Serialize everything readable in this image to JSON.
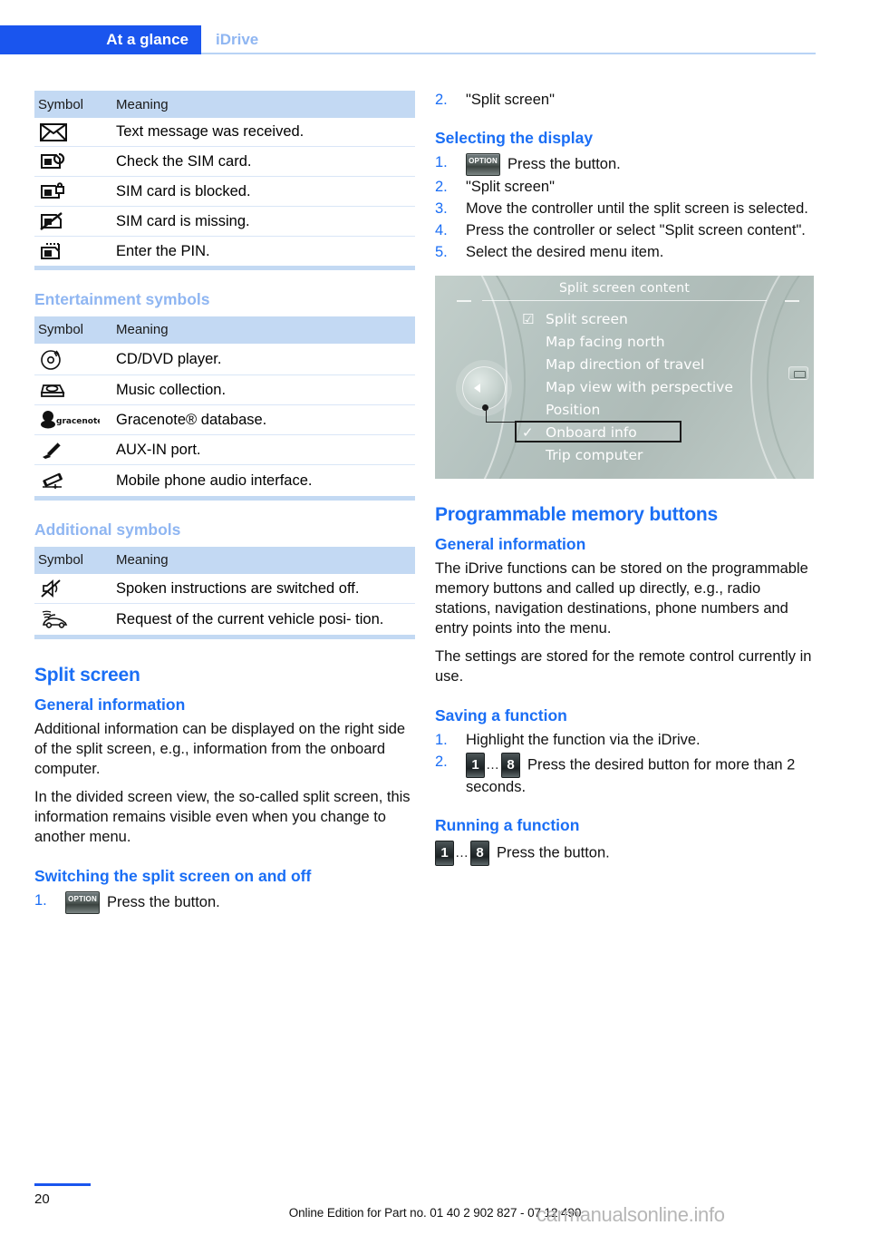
{
  "header": {
    "active_tab": "At a glance",
    "sub_tab": "iDrive"
  },
  "tables": {
    "col_headers": {
      "symbol": "Symbol",
      "meaning": "Meaning"
    },
    "telephone_rows": [
      {
        "icon": "envelope-icon",
        "meaning": "Text message was received."
      },
      {
        "icon": "sim-check-icon",
        "meaning": "Check the SIM card."
      },
      {
        "icon": "sim-locked-icon",
        "meaning": "SIM card is blocked."
      },
      {
        "icon": "sim-missing-icon",
        "meaning": "SIM card is missing."
      },
      {
        "icon": "sim-pin-icon",
        "meaning": "Enter the PIN."
      }
    ],
    "entertainment_heading": "Entertainment symbols",
    "entertainment_rows": [
      {
        "icon": "cd-dvd-icon",
        "meaning": "CD/DVD player."
      },
      {
        "icon": "music-collection-icon",
        "meaning": "Music collection."
      },
      {
        "icon": "gracenote-icon",
        "icon_label": "gracenote",
        "meaning": "Gracenote® database."
      },
      {
        "icon": "aux-in-plug-icon",
        "meaning": "AUX-IN port."
      },
      {
        "icon": "mobile-audio-interface-icon",
        "meaning": "Mobile phone audio interface."
      }
    ],
    "additional_heading": "Additional symbols",
    "additional_rows": [
      {
        "icon": "speaker-muted-icon",
        "meaning": "Spoken instructions are switched off."
      },
      {
        "icon": "vehicle-position-icon",
        "meaning": "Request of the current vehicle posi-\ntion."
      }
    ]
  },
  "split_screen": {
    "title": "Split screen",
    "general_heading": "General information",
    "general_p1": "Additional information can be displayed on the right side of the split screen, e.g., information from the onboard computer.",
    "general_p2": "In the divided screen view, the so-called split screen, this information remains visible even when you change to another menu.",
    "switching_heading": "Switching the split screen on and off",
    "switch_steps": [
      {
        "num": "1.",
        "button": "OPTION",
        "text": "Press the button."
      },
      {
        "num": "2.",
        "text": "\"Split screen\""
      }
    ],
    "selecting_heading": "Selecting the display",
    "select_steps": [
      {
        "num": "1.",
        "button": "OPTION",
        "text": "Press the button."
      },
      {
        "num": "2.",
        "text": "\"Split screen\""
      },
      {
        "num": "3.",
        "text": "Move the controller until the split screen is selected."
      },
      {
        "num": "4.",
        "text": "Press the controller or select \"Split screen content\"."
      },
      {
        "num": "5.",
        "text": "Select the desired menu item."
      }
    ]
  },
  "idrive_screen": {
    "title": "Split screen content",
    "items": [
      {
        "marker": "☑",
        "label": "Split screen"
      },
      {
        "marker": "",
        "label": "Map facing north"
      },
      {
        "marker": "",
        "label": "Map direction of travel"
      },
      {
        "marker": "",
        "label": "Map view with perspective"
      },
      {
        "marker": "",
        "label": "Position"
      },
      {
        "marker": "✓",
        "label": "Onboard info"
      },
      {
        "marker": "",
        "label": "Trip computer"
      }
    ],
    "selected_index": 5
  },
  "memory_buttons": {
    "title": "Programmable memory buttons",
    "general_heading": "General information",
    "general_p1": "The iDrive functions can be stored on the programmable memory buttons and called up directly, e.g., radio stations, navigation destinations, phone numbers and entry points into the menu.",
    "general_p2": "The settings are stored for the remote control currently in use.",
    "saving_heading": "Saving a function",
    "saving_steps": [
      {
        "num": "1.",
        "text": "Highlight the function via the iDrive."
      },
      {
        "num": "2.",
        "btn_first": "1",
        "btn_dots": "…",
        "btn_last": "8",
        "text": "Press the desired button for more than 2 seconds."
      }
    ],
    "running_heading": "Running a function",
    "running_step": {
      "btn_first": "1",
      "btn_dots": "…",
      "btn_last": "8",
      "text": "Press the button."
    }
  },
  "footer": {
    "page_number": "20",
    "note": "Online Edition for Part no. 01 40 2 902 827 - 07 12 490",
    "watermark": "carmanualsonline.info"
  },
  "colors": {
    "brand_blue": "#1a55ee",
    "link_blue": "#1a6ef5",
    "table_header": "#c3d9f3",
    "pale_blue": "#8fb6f2"
  }
}
